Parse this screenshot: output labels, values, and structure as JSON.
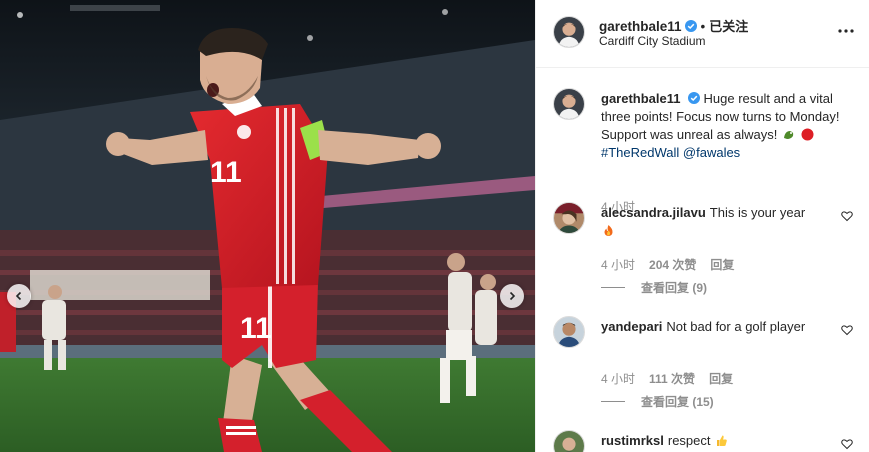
{
  "post": {
    "username": "garethbale11",
    "follow_separator": "•",
    "follow_label": "已关注",
    "location": "Cardiff City Stadium",
    "caption_text_1": "Huge result and a vital three points! Focus now turns to Monday! Support was unreal as always!",
    "caption_hashtag": "#TheRedWall",
    "caption_mention": "@fawales",
    "time": "4 小时",
    "jersey_number": "11"
  },
  "comments": [
    {
      "username": "alecsandra.jilavu",
      "text": "This is your year",
      "emoji": "fire",
      "time": "4 小时",
      "likes": "204 次赞",
      "reply": "回复",
      "view_replies": "查看回复 (9)"
    },
    {
      "username": "yandepari",
      "text": "Not bad for a golf player",
      "time": "4 小时",
      "likes": "111 次赞",
      "reply": "回复",
      "view_replies": "查看回复 (15)"
    },
    {
      "username": "rustimrksl",
      "text": "respect",
      "emoji": "thumbs-up"
    }
  ],
  "colors": {
    "verified_blue": "#3897f0",
    "link_blue": "#00376b",
    "muted_gray": "#8e8e8e",
    "wales_red": "#d4202c"
  },
  "icons": {
    "nav_prev": "chevron-left-icon",
    "nav_next": "chevron-right-icon",
    "more": "more-horizontal-icon",
    "like": "heart-outline-icon",
    "verified": "verified-badge-icon"
  }
}
